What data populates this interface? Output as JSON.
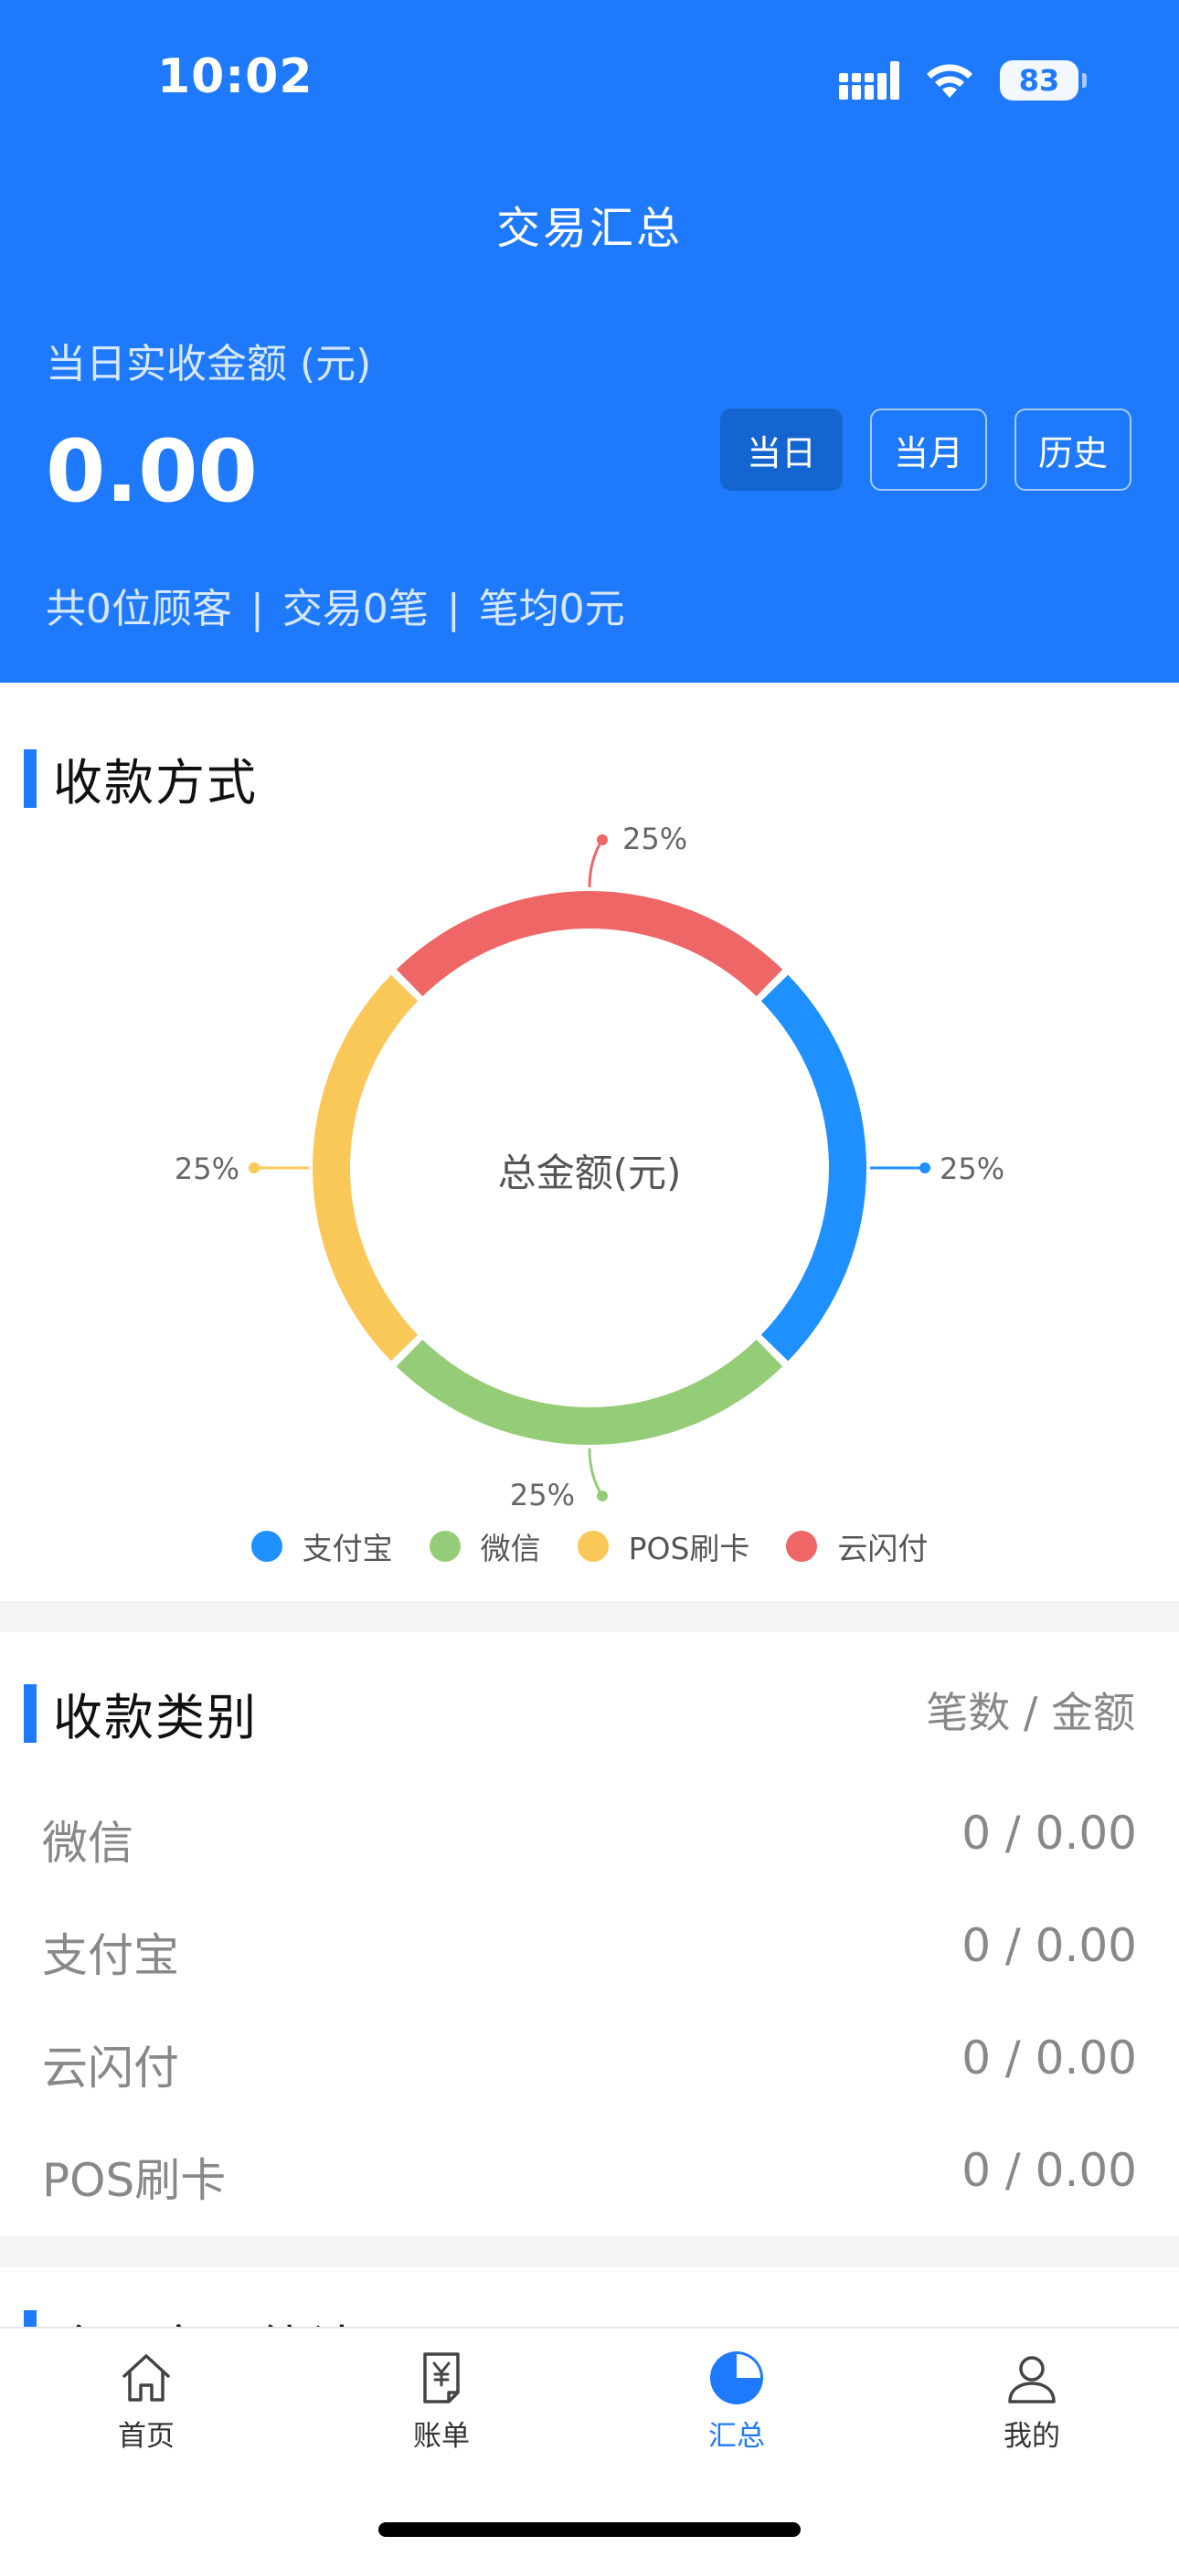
{
  "status": {
    "time": "10:02",
    "battery": "83"
  },
  "header": {
    "title": "交易汇总",
    "amount_label": "当日实收金额 (元)",
    "amount_value": "0.00",
    "tabs": [
      "当日",
      "当月",
      "历史"
    ],
    "summary": {
      "customers": "共0位顾客",
      "transactions": "交易0笔",
      "average": "笔均0元",
      "separator": "|"
    }
  },
  "payment_methods": {
    "title": "收款方式",
    "center_label": "总金额(元)",
    "slice_labels": [
      "25%",
      "25%",
      "25%",
      "25%"
    ]
  },
  "chart_data": {
    "type": "pie",
    "title": "",
    "categories": [
      "支付宝",
      "微信",
      "POS刷卡",
      "云闪付"
    ],
    "values": [
      25,
      25,
      25,
      25
    ],
    "colors": [
      "#1e90ff",
      "#95cc77",
      "#fac858",
      "#ee6666"
    ],
    "legend_position": "bottom"
  },
  "categories": {
    "title": "收款类别",
    "unit_label": "笔数 / 金额",
    "rows": [
      {
        "name": "微信",
        "value": "0 / 0.00"
      },
      {
        "name": "支付宝",
        "value": "0 / 0.00"
      },
      {
        "name": "云闪付",
        "value": "0 / 0.00"
      },
      {
        "name": "POS刷卡",
        "value": "0 / 0.00"
      }
    ]
  },
  "next_section": {
    "title": "会员交易统计(元)"
  },
  "tabbar": {
    "items": [
      {
        "label": "首页",
        "icon": "home-icon"
      },
      {
        "label": "账单",
        "icon": "bill-icon"
      },
      {
        "label": "汇总",
        "icon": "pie-chart-icon"
      },
      {
        "label": "我的",
        "icon": "user-icon"
      }
    ],
    "active": "汇总"
  }
}
